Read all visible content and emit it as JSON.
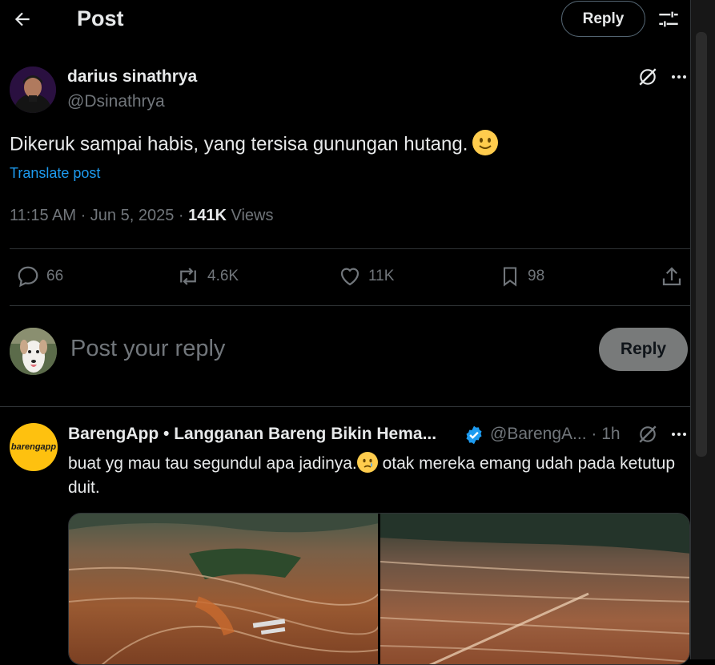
{
  "header": {
    "title": "Post",
    "reply_label": "Reply"
  },
  "post": {
    "author_name": "darius sinathrya",
    "author_handle": "@Dsinathrya",
    "text": "Dikeruk sampai habis, yang tersisa gunungan hutang.",
    "translate_label": "Translate post",
    "time": "11:15 AM · Jun 5, 2025 · ",
    "views_count": "141K",
    "views_label": " Views",
    "stats": {
      "replies": "66",
      "reposts": "4.6K",
      "likes": "11K",
      "bookmarks": "98"
    }
  },
  "composer": {
    "placeholder": "Post your reply",
    "button_label": "Reply"
  },
  "reply": {
    "author_name": "BarengApp • Langganan Bareng Bikin Hema...",
    "author_handle": "@BarengA... · 1h",
    "avatar_text": "barengapp",
    "text_part1": "buat yg mau tau segundul apa jadinya.",
    "text_part2": " otak mereka emang udah pada ketutup duit."
  },
  "colors": {
    "background": "#000000",
    "accent": "#1d9bf0",
    "muted": "#71767b",
    "verified": "#1d9bf0",
    "bareng_avatar": "#fec10f"
  }
}
